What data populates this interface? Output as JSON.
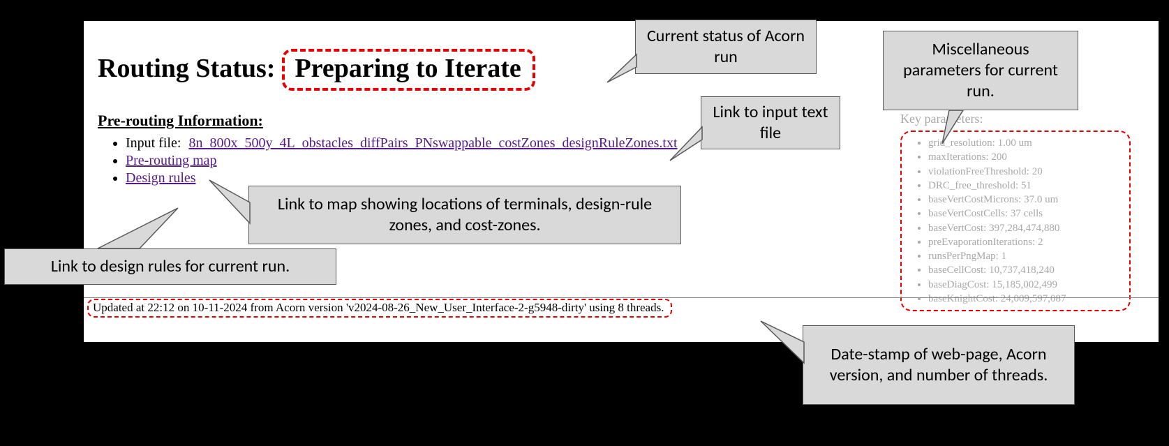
{
  "heading": {
    "prefix": "Routing Status:",
    "status": "Preparing to Iterate"
  },
  "section_title": "Pre-routing Information:",
  "input_file": {
    "label": "Input file:",
    "filename": "8n_800x_500y_4L_obstacles_diffPairs_PNswappable_costZones_designRuleZones.txt"
  },
  "preroute_map_link": "Pre-routing map",
  "design_rules_link": "Design rules",
  "key_parameters_label": "Key parameters:",
  "key_parameters": [
    "grid_resolution: 1.00 um",
    "maxIterations: 200",
    "violationFreeThreshold: 20",
    "DRC_free_threshold: 51",
    "baseVertCostMicrons: 37.0 um",
    "baseVertCostCells: 37 cells",
    "baseVertCost: 397,284,474,880",
    "preEvaporationIterations: 2",
    "runsPerPngMap: 1",
    "baseCellCost: 10,737,418,240",
    "baseDiagCost: 15,185,002,499",
    "baseKnightCost: 24,009,597,087"
  ],
  "update_line": "Updated at 22:12 on 10-11-2024 from Acorn version 'v2024-08-26_New_User_Interface-2-g5948-dirty' using 8 threads.",
  "callouts": {
    "status": "Current status of Acorn run",
    "input": "Link to input text file",
    "params": "Miscellaneous parameters for current run.",
    "map": "Link to map showing locations of terminals, design-rule zones, and cost-zones.",
    "rules": "Link to design rules for current run.",
    "stamp": "Date-stamp of web-page, Acorn version, and number of threads."
  }
}
